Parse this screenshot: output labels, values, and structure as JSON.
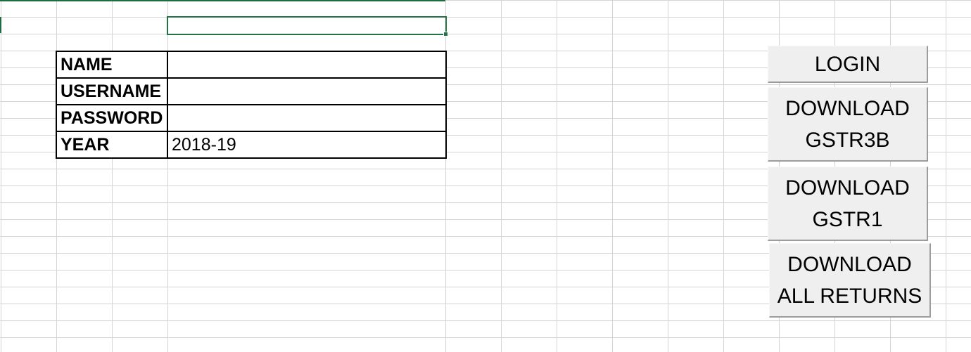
{
  "sheet": {
    "selected_cell_value": ""
  },
  "form": {
    "rows": [
      {
        "label": "NAME",
        "value": ""
      },
      {
        "label": "USERNAME",
        "value": ""
      },
      {
        "label": "PASSWORD",
        "value": ""
      },
      {
        "label": "YEAR",
        "value": "2018-19"
      }
    ]
  },
  "buttons": {
    "login": {
      "line1": "LOGIN"
    },
    "download_gstr3b": {
      "line1": "DOWNLOAD",
      "line2": "GSTR3B"
    },
    "download_gstr1": {
      "line1": "DOWNLOAD",
      "line2": "GSTR1"
    },
    "download_all": {
      "line1": "DOWNLOAD",
      "line2": "ALL RETURNS"
    }
  },
  "colors": {
    "gridline": "#d4d4d4",
    "selection": "#217346",
    "button_face": "#efefef",
    "button_shadow": "#9c9c9c"
  }
}
